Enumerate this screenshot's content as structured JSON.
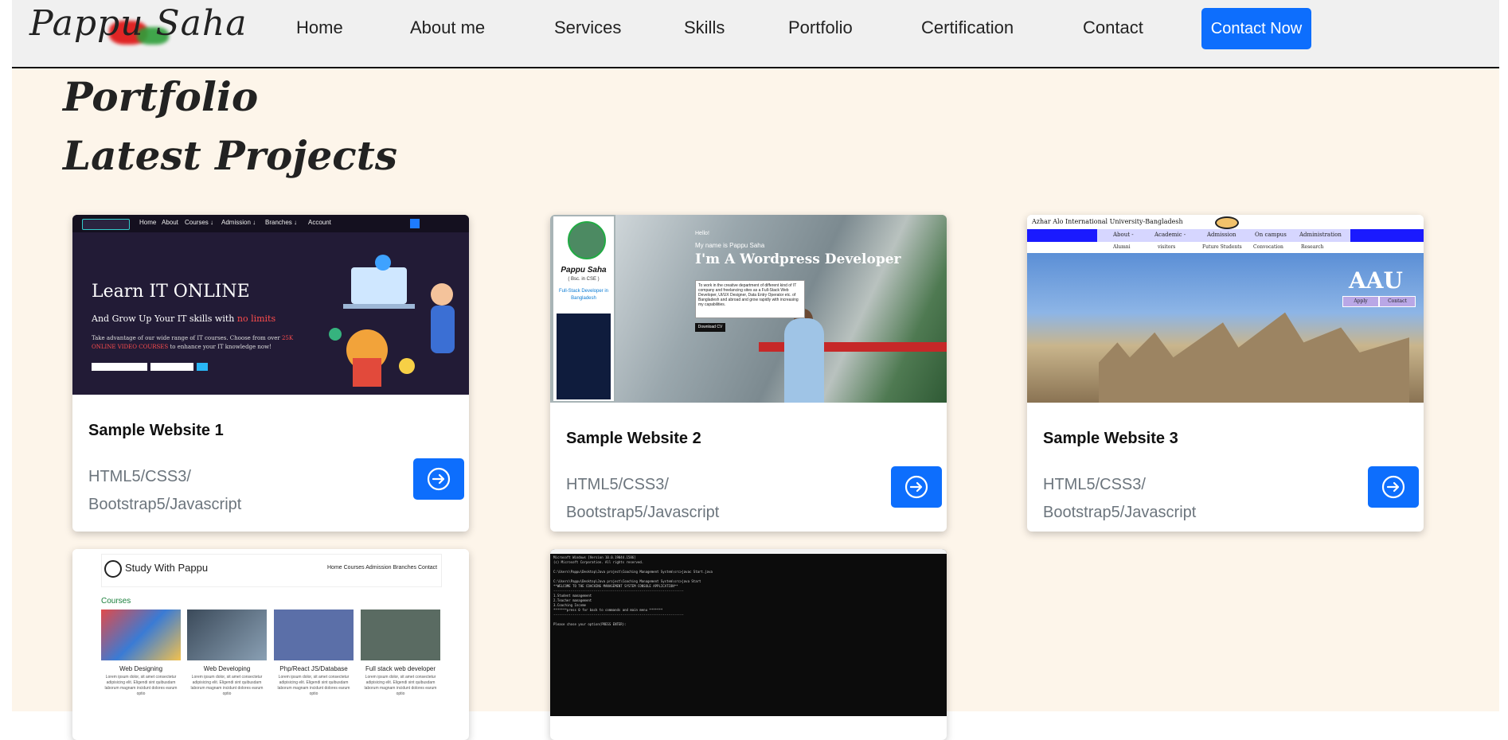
{
  "logo": {
    "text": "Pappu Saha"
  },
  "nav": {
    "items": [
      "Home",
      "About me",
      "Services",
      "Skills",
      "Portfolio",
      "Certification",
      "Contact"
    ],
    "cta_label": "Contact Now"
  },
  "section": {
    "heading": "Portfolio",
    "subheading": "Latest Projects"
  },
  "cards": [
    {
      "title": "Sample Website 1",
      "tech_line1": "HTML5/CSS3/",
      "tech_line2": "Bootstrap5/Javascript"
    },
    {
      "title": "Sample Website 2",
      "tech_line1": "HTML5/CSS3/",
      "tech_line2": "Bootstrap5/Javascript"
    },
    {
      "title": "Sample Website 3",
      "tech_line1": "HTML5/CSS3/",
      "tech_line2": "Bootstrap5/Javascript"
    }
  ],
  "thumb1": {
    "nav": [
      "Home",
      "About",
      "Courses ↓",
      "Admission ↓",
      "Branches ↓",
      "Account"
    ],
    "heading": "Learn IT ONLINE",
    "line1": "And Grow Up Your IT skills with",
    "line1_em": "no limits",
    "line2": "Take advantage of our wide range of IT courses. Choose from over",
    "line2_em": "25K ONLINE VIDEO COURSES",
    "line2_end": "to enhance your IT knowledge now!"
  },
  "thumb2": {
    "name": "Pappu Saha",
    "degree": "( Bsc. in CSE )",
    "role": "Full-Stack Developer in Bangladesh",
    "hi": "Hello!",
    "my_name": "My name is Pappu Saha",
    "title": "I'm   A Wordpress Developer",
    "quote": "To work in the creative department of different kind of IT company and freelancing sites as a Full-Stack Web Developer, UI/UX Designer, Data Entry Operator etc. of Bangladesh and abroad and grow rapidly with increasing my capabilities.",
    "download": "Download CV"
  },
  "thumb3": {
    "org": "Azhar Alo International University-Bangladesh",
    "menu": [
      "About -",
      "Academic -",
      "Admission",
      "On campus",
      "Administration"
    ],
    "sub": [
      "Alumni",
      "visitors",
      "Future Students",
      "Convocation",
      "Research"
    ],
    "brand": "AAU",
    "apply": "Apply",
    "contact": "Contact"
  },
  "thumb4": {
    "brand": "Study With Pappu",
    "links": "Home  Courses  Admission  Branches  Contact",
    "courses_label": "Courses",
    "tiles": [
      "Web Designing",
      "Web Developing",
      "Php/React JS/Database",
      "Full stack web developer"
    ],
    "lorem": "Lorem ipsum dolor, sit amet consectetur adipisicing elit. Eligendi sint quibusdam laborum magnam incidunt dolores earum optio"
  },
  "thumb5": {
    "lines": "Microsoft Windows [Version 10.0.19044.1586]\n(c) Microsoft Corporation. All rights reserved.\n\nC:\\Users\\Pappu\\Desktop\\Java project\\Coaching Management System\\src>javac Start.java\n\nC:\\Users\\Pappu\\Desktop\\Java project\\Coaching Management System\\src>java Start\n**WELCOME TO THE COACHING MANAGEMENT SYSTEM CONSOLE APPLICATION**\n--------------------------------------------------------------------\n1.Student management\n2.Teacher management\n3.Coaching Income\n*******press 0 for back to commands and main menu *******\n--------------------------------------------------------------------\n\nPlease chose your option(PRESS ENTER):"
  },
  "colors": {
    "accent": "#0d6efd",
    "page_bg": "#fdf5ea",
    "nav_bg": "#f0f0f0"
  },
  "icons": {
    "card_button": "arrow-right-circle-icon"
  }
}
